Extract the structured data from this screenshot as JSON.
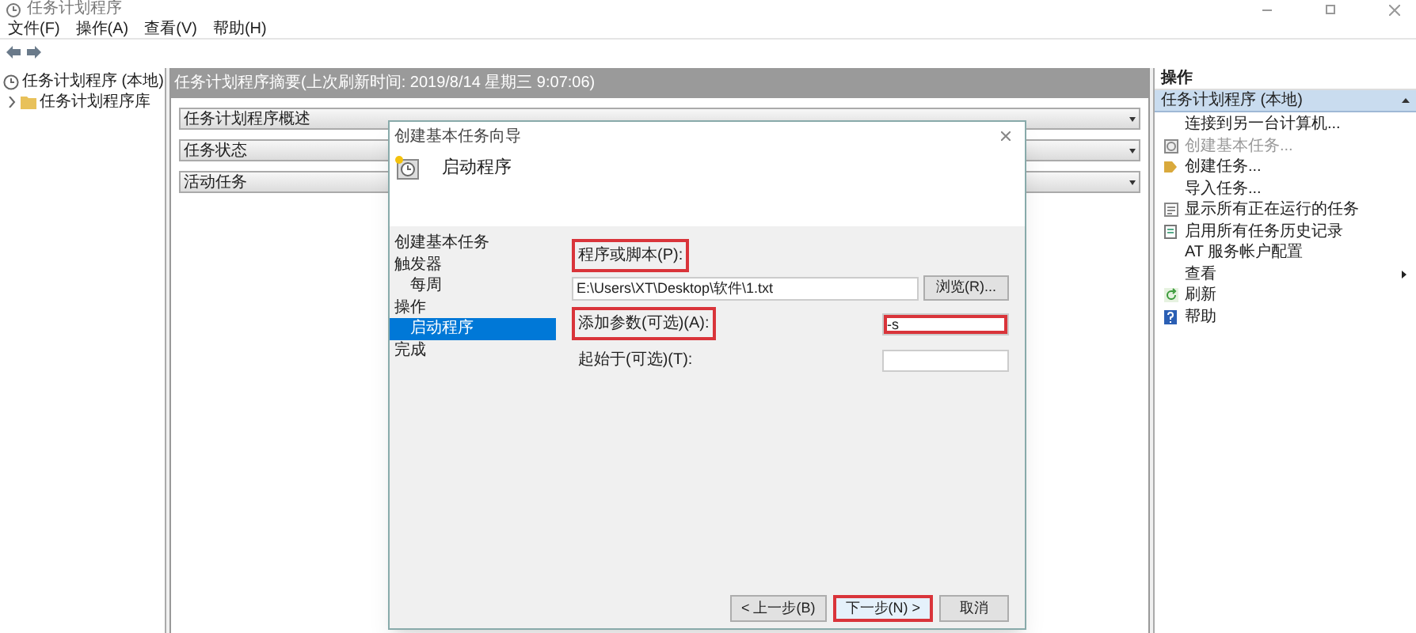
{
  "window": {
    "title": "任务计划程序"
  },
  "menu": [
    "文件(F)",
    "操作(A)",
    "查看(V)",
    "帮助(H)"
  ],
  "tree": [
    {
      "label": "任务计划程序 (本地)",
      "kind": "clock",
      "expanded": true,
      "children": [
        {
          "label": "任务计划程序库",
          "kind": "folder",
          "expanded": false
        }
      ]
    }
  ],
  "summary": {
    "header": "任务计划程序摘要(上次刷新时间: 2019/8/14 星期三 9:07:06)",
    "sections": [
      {
        "label": "任务计划程序概述",
        "expanded": false
      },
      {
        "label": "任务状态",
        "expanded": false
      },
      {
        "label": "活动任务",
        "expanded": false
      }
    ]
  },
  "dialog": {
    "title": "创建基本任务向导",
    "heading": "启动程序",
    "steps": [
      {
        "label": "创建基本任务",
        "selected": false
      },
      {
        "label": "触发器",
        "selected": false,
        "children": [
          {
            "label": "每周",
            "selected": false
          }
        ]
      },
      {
        "label": "操作",
        "selected": false,
        "children": [
          {
            "label": "启动程序",
            "selected": true
          }
        ]
      },
      {
        "label": "完成",
        "selected": false
      }
    ],
    "program": {
      "label": "程序或脚本(P):",
      "label_highlighted": true,
      "value": "E:\\Users\\XT\\Desktop\\软件\\1.txt",
      "value_highlighted": false,
      "button": "浏览(R)..."
    },
    "arguments": {
      "label": "添加参数(可选)(A):",
      "label_highlighted": true,
      "value": "-s",
      "value_highlighted": true
    },
    "start_in": {
      "label": "起始于(可选)(T):",
      "label_highlighted": false,
      "value_highlighted": false
    },
    "buttons": [
      {
        "label": "< 上一步(B)",
        "highlighted": false
      },
      {
        "label": "下一步(N) >",
        "highlighted": true
      },
      {
        "label": "取消",
        "highlighted": false
      }
    ]
  },
  "actions": {
    "title": "操作",
    "section": {
      "label": "任务计划程序 (本地)",
      "expanded": true
    },
    "items": [
      {
        "label": "连接到另一台计算机...",
        "kind": "plain",
        "disabled": false,
        "submenu": false
      },
      {
        "label": "创建基本任务...",
        "kind": "wizard",
        "disabled": true,
        "submenu": false
      },
      {
        "label": "创建任务...",
        "kind": "task",
        "disabled": false,
        "submenu": false
      },
      {
        "label": "导入任务...",
        "kind": "plain",
        "disabled": false,
        "submenu": false
      },
      {
        "label": "显示所有正在运行的任务",
        "kind": "list",
        "disabled": false,
        "submenu": false
      },
      {
        "label": "启用所有任务历史记录",
        "kind": "history",
        "disabled": false,
        "submenu": false
      },
      {
        "label": "AT 服务帐户配置",
        "kind": "plain",
        "disabled": false,
        "submenu": false
      },
      {
        "label": "查看",
        "kind": "plain",
        "disabled": false,
        "submenu": true
      },
      {
        "label": "刷新",
        "kind": "refresh",
        "disabled": false,
        "submenu": false
      },
      {
        "label": "帮助",
        "kind": "help",
        "disabled": false,
        "submenu": false
      }
    ]
  }
}
